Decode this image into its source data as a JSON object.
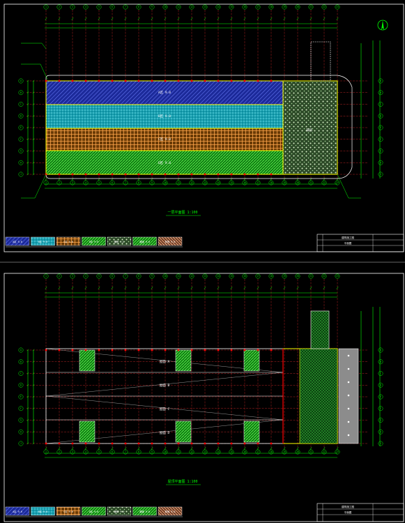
{
  "colors": {
    "background": "#000000",
    "frame": "#ffffff",
    "axis_line": "#ff3030",
    "dimension": "#00ff00",
    "wall": "#ffff00",
    "room_blue": "#3a4fff",
    "room_cyan": "#00c8d8",
    "room_orange": "#ff9c2a",
    "room_green": "#33ff33",
    "room_pale": "#d8f0c8",
    "room_peach": "#ffb080",
    "marker_red": "#ff0000",
    "road_grey": "#909090"
  },
  "sheets": [
    {
      "id": "sheet-1",
      "title_text": "一层平面图  1:100",
      "zones": [
        {
          "key": "z1",
          "label": "A区 9.0",
          "fill": "room_blue"
        },
        {
          "key": "z2",
          "label": "B区 9.0",
          "fill": "room_cyan"
        },
        {
          "key": "z3",
          "label": "C区 9.0",
          "fill": "room_orange"
        },
        {
          "key": "z4",
          "label": "D区 9.0",
          "fill": "room_green"
        },
        {
          "key": "z5",
          "label": "辅房",
          "fill": "room_pale"
        }
      ]
    },
    {
      "id": "sheet-2",
      "title_text": "屋顶平面图  1:100",
      "zones": [
        {
          "key": "r1",
          "label": "屋面 A"
        },
        {
          "key": "r2",
          "label": "屋面 B"
        },
        {
          "key": "r3",
          "label": "屋面 C"
        },
        {
          "key": "r4",
          "label": "屋面 D"
        }
      ]
    }
  ],
  "legend": [
    {
      "label": "A区 9.0",
      "fill": "room_blue"
    },
    {
      "label": "B区 9.0",
      "fill": "room_cyan"
    },
    {
      "label": "C区 9.0",
      "fill": "room_orange"
    },
    {
      "label": "D区 9.0",
      "fill": "room_green"
    },
    {
      "label": "辅房 9.0",
      "fill": "room_pale"
    },
    {
      "label": "通道 9.0",
      "fill": "room_green"
    },
    {
      "label": "其他 9.0",
      "fill": "room_peach"
    }
  ],
  "grid_col_labels": [
    "1",
    "2",
    "3",
    "4",
    "5",
    "6",
    "7",
    "8",
    "9",
    "10",
    "11",
    "12",
    "13",
    "14",
    "15",
    "16",
    "17",
    "18",
    "19",
    "20",
    "21",
    "22",
    "23"
  ],
  "grid_row_labels": [
    "A",
    "B",
    "C",
    "D",
    "E",
    "F",
    "G",
    "H",
    "J"
  ],
  "title_block": {
    "line1": "建筑施工图",
    "line2": "平面图"
  }
}
